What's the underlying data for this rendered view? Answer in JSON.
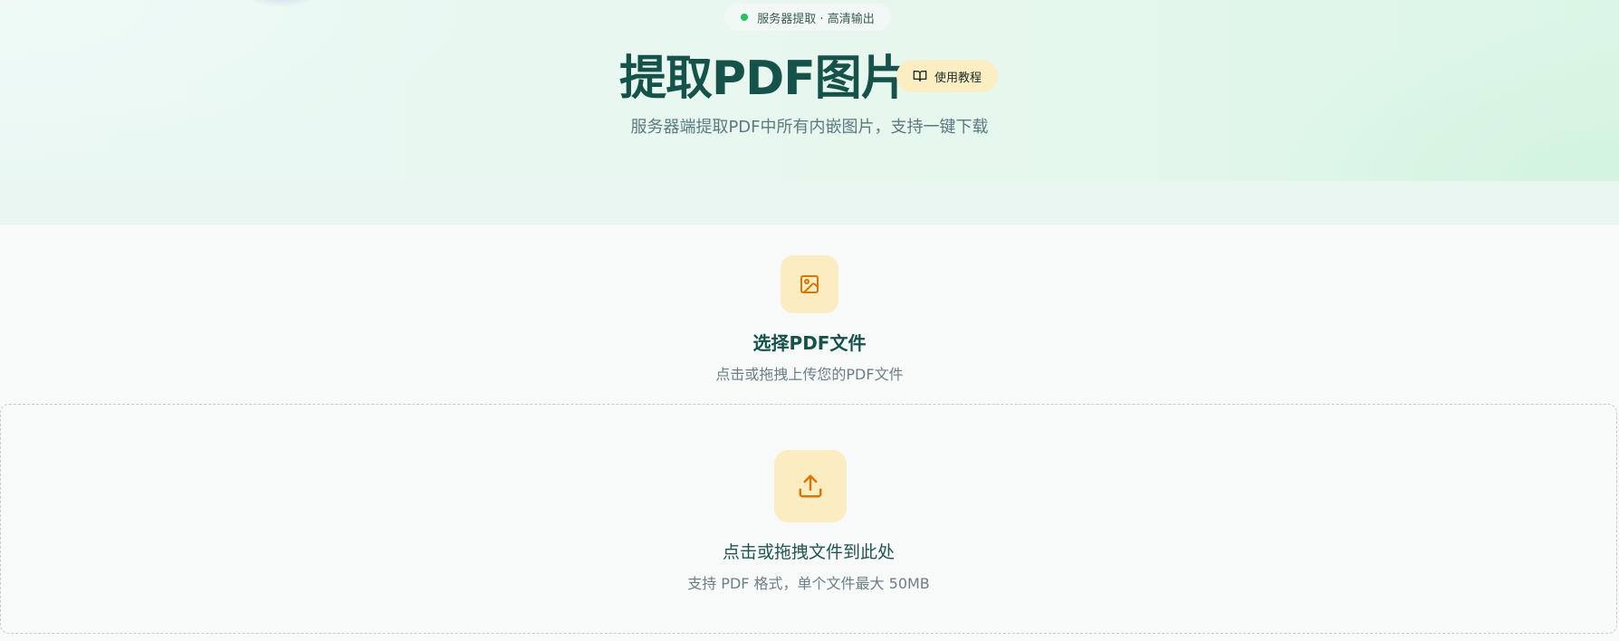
{
  "hero": {
    "status_text": "服务器提取 · 高清输出",
    "title": "提取PDF图片",
    "tutorial_label": "使用教程",
    "subtitle": "服务器端提取PDF中所有内嵌图片，支持一键下载"
  },
  "select_card": {
    "title": "选择PDF文件",
    "description": "点击或拖拽上传您的PDF文件"
  },
  "dropzone": {
    "title": "点击或拖拽文件到此处",
    "hint": "支持 PDF 格式，单个文件最大 50MB"
  },
  "icons": {
    "tutorial": "book-open-icon",
    "select": "image-icon",
    "upload": "upload-icon"
  },
  "colors": {
    "primary_text": "#14524a",
    "status_dot": "#22c55e",
    "accent_bg": "#fcecc2",
    "icon_orange": "#d97706",
    "muted_text": "#6b7f86"
  }
}
